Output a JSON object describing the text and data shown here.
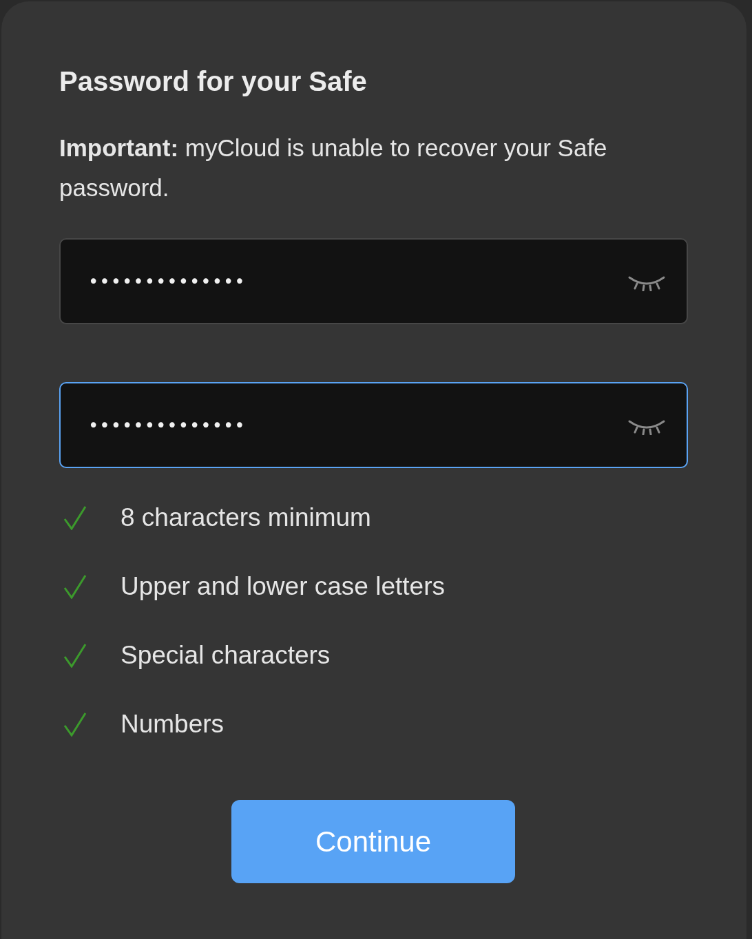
{
  "title": "Password for your Safe",
  "notice": "**Important:** myCloud is unable to recover your Safe password.",
  "fields": [
    {
      "value": "••••••••••••••",
      "focused": false
    },
    {
      "value": "••••••••••••••",
      "focused": true
    }
  ],
  "requirements": [
    {
      "label": "8 characters minimum",
      "met": true
    },
    {
      "label": "Upper and lower case letters",
      "met": true
    },
    {
      "label": "Special characters",
      "met": true
    },
    {
      "label": "Numbers",
      "met": true
    }
  ],
  "button": "Continue"
}
